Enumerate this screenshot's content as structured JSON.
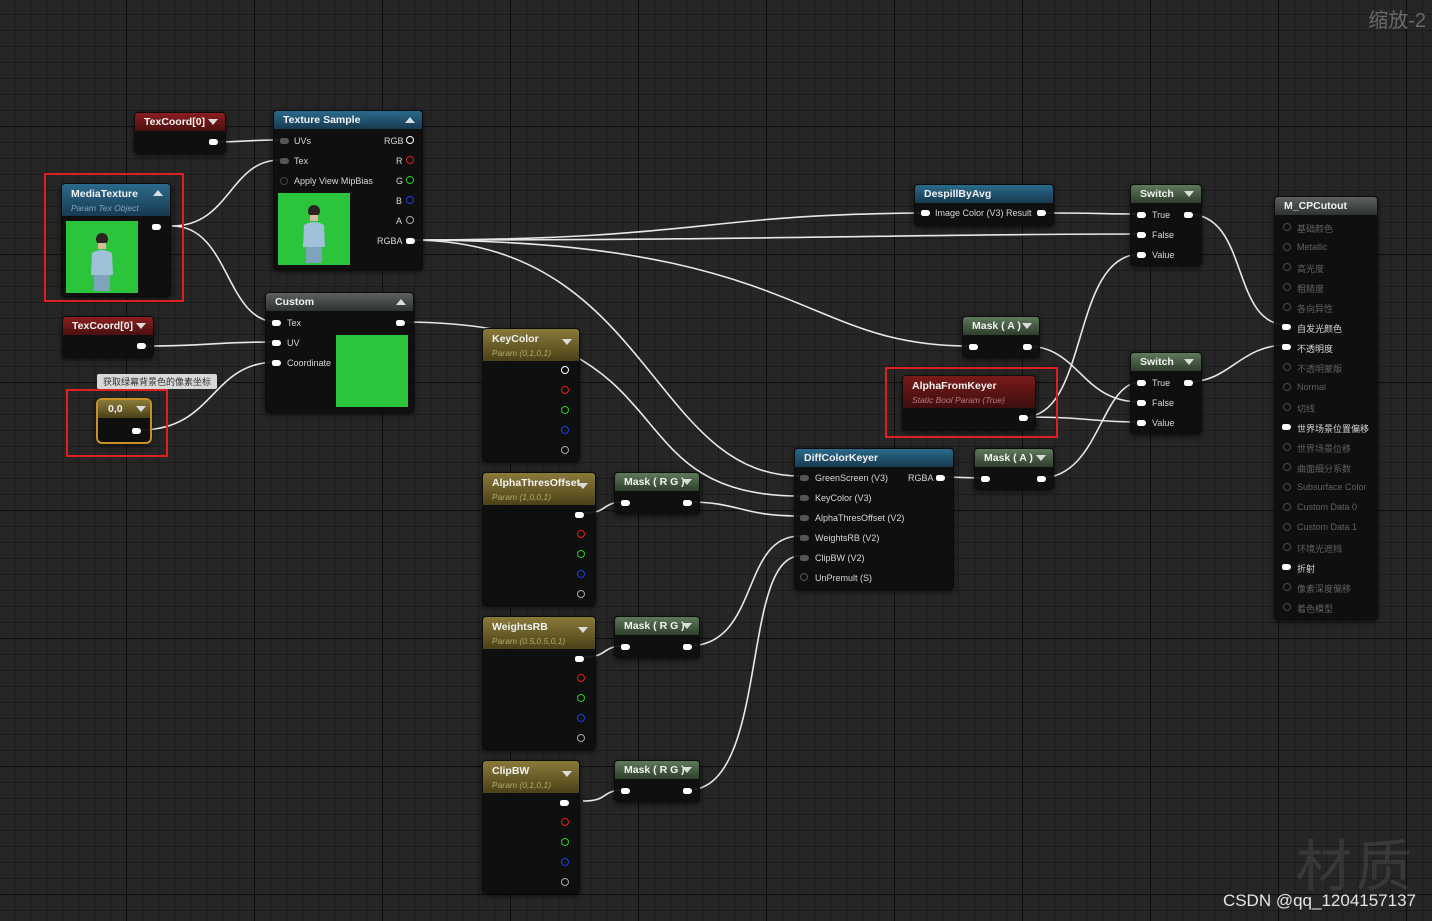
{
  "zoom_label": "缩放-2",
  "domain_watermark": "材质",
  "credit": "CSDN @qq_1204157137",
  "comment": "获取绿幕背景色的像素坐标",
  "nodes": {
    "texcoord_top": {
      "title": "TexCoord[0]"
    },
    "texcoord_left": {
      "title": "TexCoord[0]"
    },
    "texture_sample": {
      "title": "Texture Sample",
      "inputs": [
        "UVs",
        "Tex",
        "Apply View MipBias"
      ],
      "outputs": [
        "RGB",
        "R",
        "G",
        "B",
        "A",
        "RGBA"
      ]
    },
    "media_texture": {
      "title": "MediaTexture",
      "subtitle": "Param Tex Object"
    },
    "custom": {
      "title": "Custom",
      "inputs": [
        "Tex",
        "UV",
        "Coordinate"
      ]
    },
    "constant": {
      "title": "0,0"
    },
    "despill": {
      "title": "DespillByAvg",
      "pin": "Image Color (V3) Result"
    },
    "switch_top": {
      "title": "Switch",
      "inputs": [
        "True",
        "False",
        "Value"
      ]
    },
    "switch_bottom": {
      "title": "Switch",
      "inputs": [
        "True",
        "False",
        "Value"
      ]
    },
    "mask_a_top": {
      "title": "Mask ( A )"
    },
    "mask_a_mid": {
      "title": "Mask ( A )"
    },
    "alpha_from_keyer": {
      "title": "AlphaFromKeyer",
      "subtitle": "Static Bool Param (True)"
    },
    "keycolor": {
      "title": "KeyColor",
      "subtitle": "Param (0,1,0,1)"
    },
    "alpha_thres": {
      "title": "AlphaThresOffset",
      "subtitle": "Param (1,0,0,1)"
    },
    "weights_rb": {
      "title": "WeightsRB",
      "subtitle": "Param (0.5,0.5,0,1)"
    },
    "clip_bw": {
      "title": "ClipBW",
      "subtitle": "Param (0,1,0,1)"
    },
    "mask_rg_1": {
      "title": "Mask ( R G )"
    },
    "mask_rg_2": {
      "title": "Mask ( R G )"
    },
    "mask_rg_3": {
      "title": "Mask ( R G )"
    },
    "diff_keyer": {
      "title": "DiffColorKeyer",
      "output": "RGBA",
      "inputs": [
        "GreenScreen (V3)",
        "KeyColor (V3)",
        "AlphaThresOffset (V2)",
        "WeightsRB (V2)",
        "ClipBW (V2)",
        "UnPremult (S)"
      ]
    },
    "material": {
      "title": "M_CPCutout",
      "pins": [
        {
          "label": "基础颜色",
          "active": false
        },
        {
          "label": "Metallic",
          "active": false
        },
        {
          "label": "高光度",
          "active": false
        },
        {
          "label": "粗糙度",
          "active": false
        },
        {
          "label": "各向异性",
          "active": false
        },
        {
          "label": "自发光颜色",
          "active": true
        },
        {
          "label": "不透明度",
          "active": true
        },
        {
          "label": "不透明蒙版",
          "active": false
        },
        {
          "label": "Normal",
          "active": false
        },
        {
          "label": "切线",
          "active": false
        },
        {
          "label": "世界场景位置偏移",
          "active": true
        },
        {
          "label": "世界场景位移",
          "active": false
        },
        {
          "label": "曲面细分系数",
          "active": false
        },
        {
          "label": "Subsurface Color",
          "active": false
        },
        {
          "label": "Custom Data 0",
          "active": false
        },
        {
          "label": "Custom Data 1",
          "active": false
        },
        {
          "label": "环境光遮挡",
          "active": false
        },
        {
          "label": "折射",
          "active": true
        },
        {
          "label": "像素深度偏移",
          "active": false
        },
        {
          "label": "着色模型",
          "active": false
        }
      ]
    }
  }
}
